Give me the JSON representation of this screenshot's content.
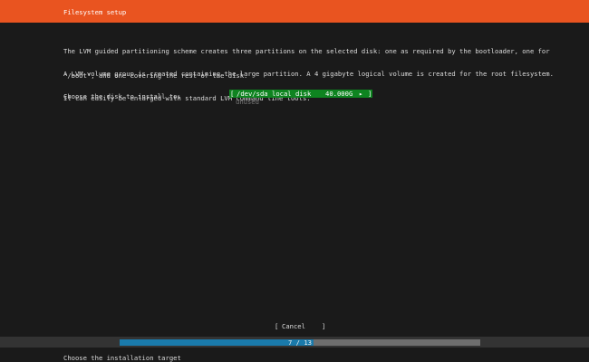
{
  "header": {
    "title": "Filesystem setup"
  },
  "description": {
    "paragraph1": [
      "The LVM guided partitioning scheme creates three partitions on the selected disk: one as required by the bootloader, one for",
      "'/boot', and one covering the rest of the disk."
    ],
    "paragraph2": [
      "A LVM volume group is created containing the large partition. A 4 gigabyte logical volume is created for the root filesystem.",
      "It can easily be enlarged with standard LVM command line tools."
    ],
    "prompt": "Choose the disk to install to:"
  },
  "disk_list": {
    "items": [
      {
        "open_bracket": "[",
        "path": "/dev/sda",
        "type": "local disk",
        "size": "40.000G",
        "arrow": "▸",
        "close_bracket": "]",
        "sub_label": "unused"
      }
    ]
  },
  "buttons": {
    "cancel_open": "[",
    "cancel_label": "Cancel",
    "cancel_close": "]"
  },
  "progress": {
    "label": "7 / 13",
    "current": 7,
    "total": 13
  },
  "status_bar": {
    "text": "Choose the installation target"
  },
  "colors": {
    "header": "#e95420",
    "selection": "#0e8420",
    "progress_fill": "#1a7aab",
    "progress_track": "#6e6e6e",
    "background": "#1a1a1a"
  }
}
